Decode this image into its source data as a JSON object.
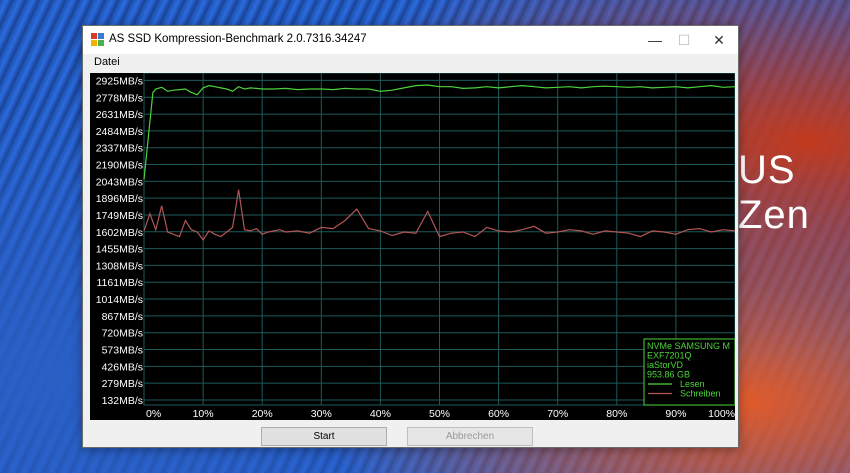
{
  "desktop": {
    "wallpaper_text": "US Zen"
  },
  "window": {
    "title": "AS SSD Kompression-Benchmark 2.0.7316.34247",
    "menu": [
      "Datei"
    ],
    "buttons": {
      "start": "Start",
      "abort": "Abbrechen"
    },
    "minimize_glyph": "—",
    "maximize_glyph": "☐",
    "close_glyph": "✕"
  },
  "colors": {
    "read": "#4cd33a",
    "write": "#b25656",
    "grid": "#1e5a5a",
    "label_bg": "#ffffff"
  },
  "chart_data": {
    "type": "line",
    "y_tick_labels": [
      "2925MB/s",
      "2778MB/s",
      "2631MB/s",
      "2484MB/s",
      "2337MB/s",
      "2190MB/s",
      "2043MB/s",
      "1896MB/s",
      "1749MB/s",
      "1602MB/s",
      "1455MB/s",
      "1308MB/s",
      "1161MB/s",
      "1014MB/s",
      "867MB/s",
      "720MB/s",
      "573MB/s",
      "426MB/s",
      "279MB/s",
      "132MB/s"
    ],
    "y_ticks": [
      2925,
      2778,
      2631,
      2484,
      2337,
      2190,
      2043,
      1896,
      1749,
      1602,
      1455,
      1308,
      1161,
      1014,
      867,
      720,
      573,
      426,
      279,
      132
    ],
    "x_tick_labels": [
      "0%",
      "10%",
      "20%",
      "30%",
      "40%",
      "50%",
      "60%",
      "70%",
      "80%",
      "90%",
      "100%"
    ],
    "x_ticks": [
      0,
      10,
      20,
      30,
      40,
      50,
      60,
      70,
      80,
      90,
      100
    ],
    "xlim": [
      0,
      100
    ],
    "ylim": [
      88,
      2990
    ],
    "grid": true,
    "legend_position": "bottom-right",
    "info_box": [
      "NVMe SAMSUNG M",
      "EXF7201Q",
      "iaStorVD",
      "953.86 GB"
    ],
    "series": [
      {
        "name": "Lesen",
        "x": [
          0,
          1.5,
          2,
          3,
          4,
          5,
          6,
          7,
          8,
          9,
          10,
          11,
          12,
          13,
          14,
          15,
          16,
          17,
          18,
          19,
          20,
          22,
          24,
          26,
          28,
          30,
          32,
          34,
          36,
          38,
          40,
          42,
          44,
          46,
          48,
          50,
          52,
          54,
          56,
          58,
          60,
          62,
          64,
          66,
          68,
          70,
          72,
          74,
          76,
          78,
          80,
          82,
          84,
          86,
          88,
          90,
          92,
          94,
          96,
          98,
          100
        ],
        "values": [
          2060,
          2820,
          2850,
          2865,
          2830,
          2840,
          2845,
          2850,
          2820,
          2800,
          2860,
          2880,
          2870,
          2860,
          2850,
          2830,
          2870,
          2850,
          2860,
          2855,
          2850,
          2850,
          2855,
          2845,
          2850,
          2850,
          2845,
          2855,
          2850,
          2850,
          2830,
          2840,
          2860,
          2880,
          2885,
          2870,
          2870,
          2855,
          2860,
          2870,
          2860,
          2870,
          2880,
          2870,
          2860,
          2865,
          2870,
          2860,
          2870,
          2875,
          2870,
          2865,
          2870,
          2860,
          2865,
          2870,
          2860,
          2870,
          2880,
          2865,
          2870
        ]
      },
      {
        "name": "Schreiben",
        "x": [
          0,
          1,
          2,
          3,
          4,
          5,
          6,
          7,
          8,
          9,
          10,
          11,
          12,
          13,
          14,
          15,
          16,
          17,
          18,
          19,
          20,
          21,
          22,
          23,
          24,
          26,
          28,
          30,
          32,
          34,
          36,
          38,
          40,
          42,
          44,
          46,
          48,
          50,
          52,
          54,
          56,
          58,
          60,
          62,
          64,
          66,
          68,
          70,
          72,
          74,
          76,
          78,
          80,
          82,
          84,
          86,
          88,
          90,
          92,
          94,
          96,
          98,
          100
        ],
        "values": [
          1610,
          1760,
          1620,
          1830,
          1600,
          1580,
          1560,
          1700,
          1620,
          1600,
          1530,
          1610,
          1580,
          1560,
          1600,
          1640,
          1970,
          1620,
          1610,
          1630,
          1580,
          1600,
          1610,
          1620,
          1600,
          1610,
          1590,
          1640,
          1630,
          1700,
          1800,
          1630,
          1610,
          1570,
          1600,
          1590,
          1780,
          1560,
          1590,
          1600,
          1560,
          1640,
          1610,
          1600,
          1620,
          1650,
          1590,
          1600,
          1620,
          1610,
          1580,
          1610,
          1600,
          1590,
          1560,
          1610,
          1600,
          1580,
          1620,
          1630,
          1600,
          1620,
          1610
        ]
      }
    ]
  }
}
